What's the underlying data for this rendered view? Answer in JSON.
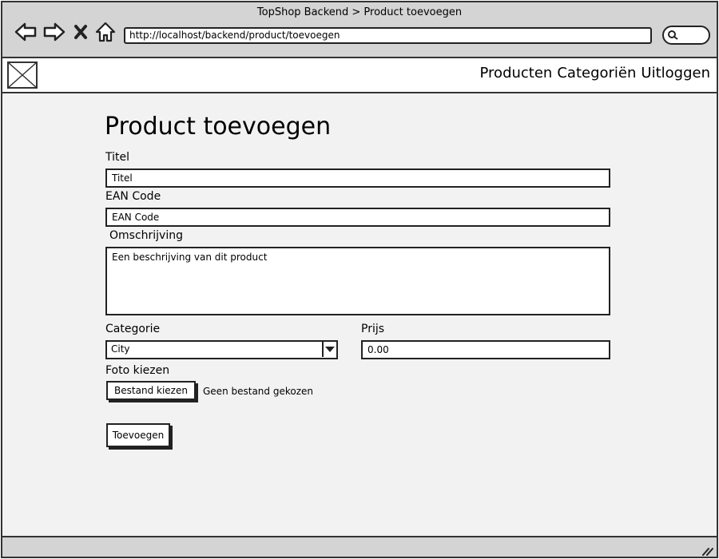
{
  "browser": {
    "window_title": "TopShop Backend > Product toevoegen",
    "url": "http://localhost/backend/product/toevoegen",
    "icons": {
      "back": "back-arrow-icon",
      "forward": "forward-arrow-icon",
      "stop": "close-icon",
      "home": "home-icon",
      "search": "search-icon"
    }
  },
  "header": {
    "logo": "image-placeholder-icon",
    "nav": [
      {
        "label": "Producten"
      },
      {
        "label": "Categoriën"
      },
      {
        "label": "Uitloggen"
      }
    ]
  },
  "form": {
    "page_title": "Product toevoegen",
    "titel": {
      "label": "Titel",
      "value": "Titel"
    },
    "ean": {
      "label": "EAN Code",
      "value": "EAN Code"
    },
    "omschrijving": {
      "label": "Omschrijving",
      "value": "Een beschrijving van dit product"
    },
    "categorie": {
      "label": "Categorie",
      "selected": "City"
    },
    "prijs": {
      "label": "Prijs",
      "value": "0.00"
    },
    "foto": {
      "label": "Foto kiezen",
      "button_label": "Bestand kiezen",
      "status": "Geen bestand gekozen"
    },
    "submit_label": "Toevoegen"
  }
}
